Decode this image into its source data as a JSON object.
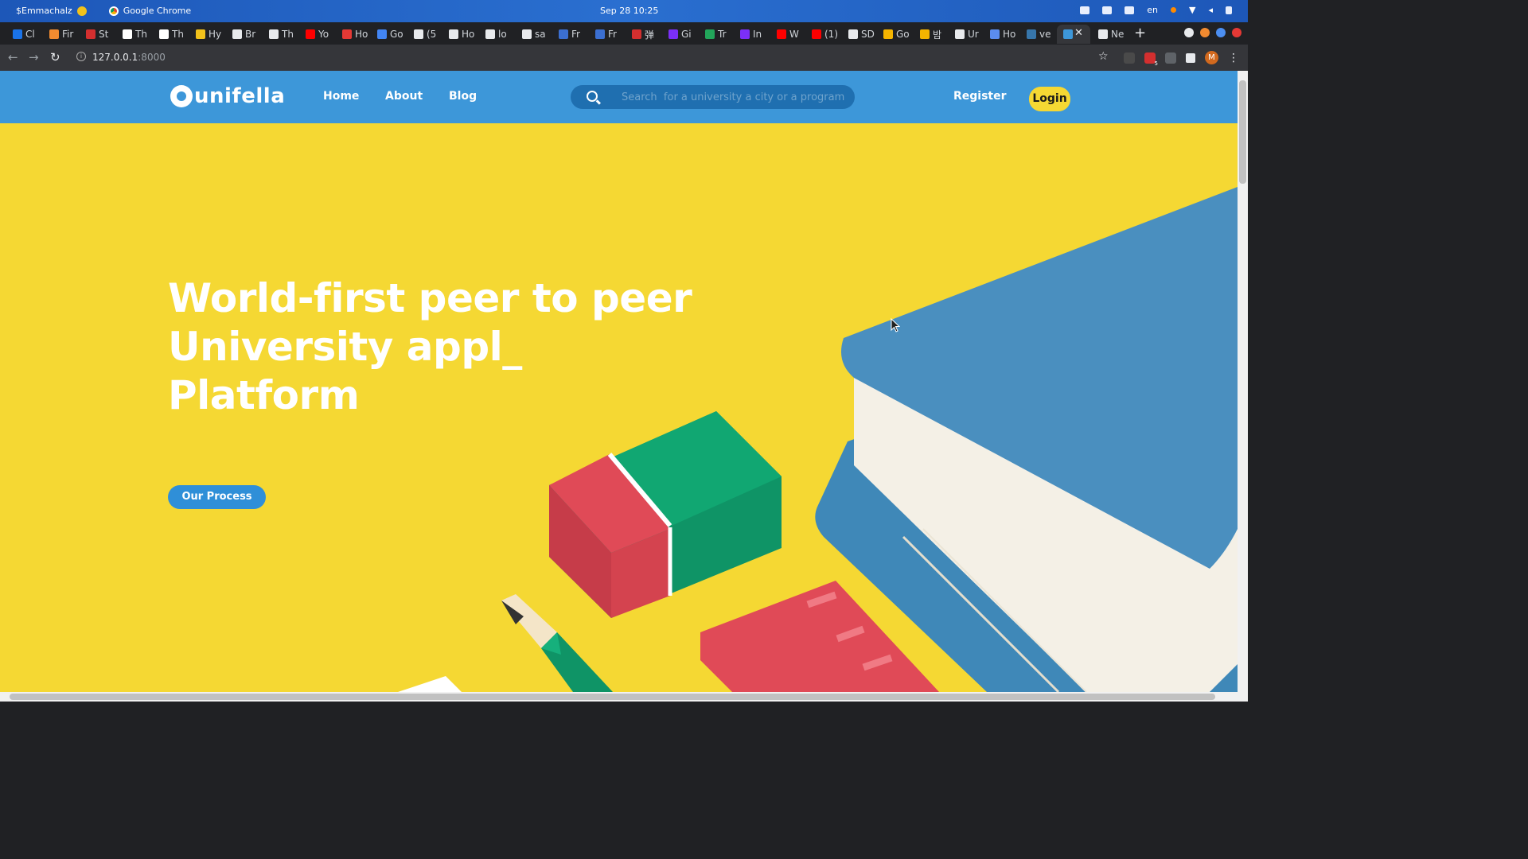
{
  "os": {
    "user": "$Emmachalz",
    "app": "Google Chrome",
    "clock": "Sep 28  10:25",
    "lang": "en"
  },
  "tabs": [
    {
      "label": "Cl",
      "favicon_color": "#1a73e8"
    },
    {
      "label": "Fir",
      "favicon_color": "#f28b30"
    },
    {
      "label": "St",
      "favicon_color": "#d32f2f"
    },
    {
      "label": "Th",
      "favicon_color": "#ffffff"
    },
    {
      "label": "Th",
      "favicon_color": "#ffffff"
    },
    {
      "label": "Hy",
      "favicon_color": "#f2c21b"
    },
    {
      "label": "Br",
      "favicon_color": "#e8eaed"
    },
    {
      "label": "Th",
      "favicon_color": "#e8eaed"
    },
    {
      "label": "Yo",
      "favicon_color": "#ff0000"
    },
    {
      "label": "Ho",
      "favicon_color": "#e53935"
    },
    {
      "label": "Go",
      "favicon_color": "#4285f4"
    },
    {
      "label": "(5",
      "favicon_color": "#e8eaed"
    },
    {
      "label": "Ho",
      "favicon_color": "#e8eaed"
    },
    {
      "label": "lo",
      "favicon_color": "#e8eaed"
    },
    {
      "label": "sa",
      "favicon_color": "#e8eaed"
    },
    {
      "label": "Fr",
      "favicon_color": "#3b6fd1"
    },
    {
      "label": "Fr",
      "favicon_color": "#3b6fd1"
    },
    {
      "label": "弹",
      "favicon_color": "#d32f2f"
    },
    {
      "label": "Gi",
      "favicon_color": "#7b2ff7"
    },
    {
      "label": "Tr",
      "favicon_color": "#22a55a"
    },
    {
      "label": "In",
      "favicon_color": "#7b2ff7"
    },
    {
      "label": "W",
      "favicon_color": "#ff0000"
    },
    {
      "label": "(1)",
      "favicon_color": "#ff0000"
    },
    {
      "label": "SD",
      "favicon_color": "#e8eaed"
    },
    {
      "label": "Go",
      "favicon_color": "#f4b400"
    },
    {
      "label": "밤",
      "favicon_color": "#f4b400"
    },
    {
      "label": "Ur",
      "favicon_color": "#e8eaed"
    },
    {
      "label": "Ho",
      "favicon_color": "#5b8def"
    },
    {
      "label": "ve",
      "favicon_color": "#3776ab"
    },
    {
      "label": "",
      "favicon_color": "#3d97d9"
    },
    {
      "label": "Ne",
      "favicon_color": "#e8eaed"
    }
  ],
  "browser": {
    "url_host": "127.0.0.1",
    "url_port": ":8000",
    "avatar_letter": "M",
    "extension_badge": "5"
  },
  "site": {
    "brand": "unifella",
    "nav": [
      "Home",
      "About",
      "Blog"
    ],
    "search_placeholder": "Search  for a university a city or a program",
    "register_label": "Register",
    "login_label": "Login",
    "hero_lines": [
      "World-first peer to peer",
      "University appl_",
      "Platform"
    ],
    "cta_label": "Our Process"
  },
  "colors": {
    "header_blue": "#3d97d9",
    "hero_yellow": "#f5d833",
    "book_blue": "#4a8fbf",
    "eraser_red": "#e04a57",
    "eraser_green": "#109d6b"
  }
}
